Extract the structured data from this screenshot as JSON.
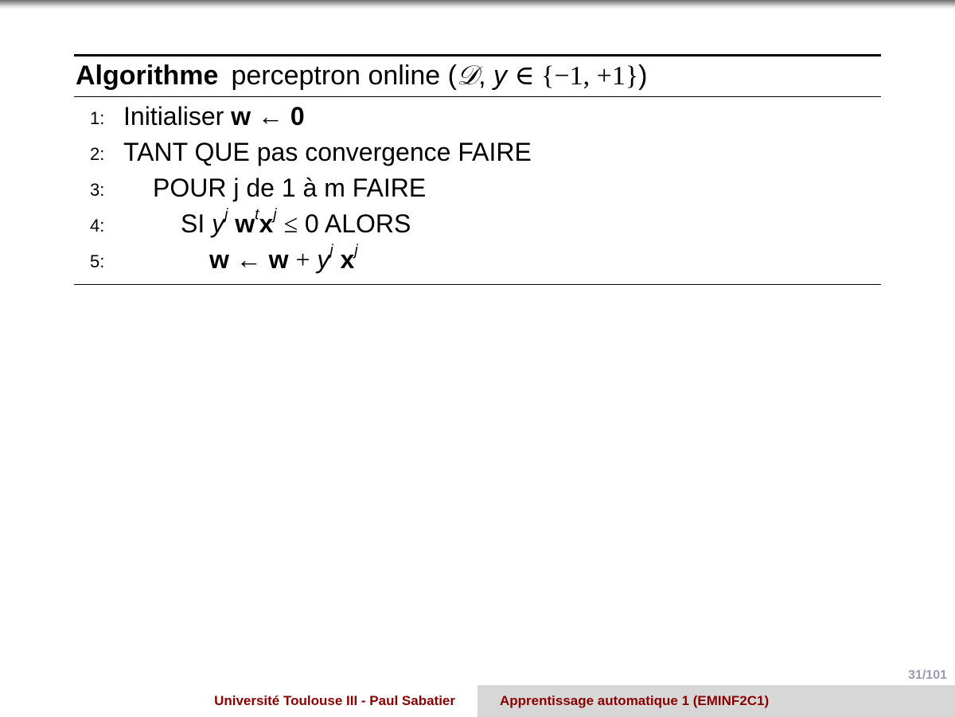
{
  "algorithm": {
    "keyword": "Algorithme",
    "name": "perceptron online",
    "args_math": "(𝒟, y ∈ {−1, +1})",
    "lines": [
      {
        "num": "1:",
        "text_a": "Initialiser",
        "w": "w",
        "arrow": "←",
        "zero": "0"
      },
      {
        "num": "2:",
        "text": "TANT QUE pas convergence FAIRE"
      },
      {
        "num": "3:",
        "text": "POUR j de 1 à m FAIRE"
      },
      {
        "num": "4:",
        "si": "SI",
        "y": "y",
        "j": "j",
        "w": "w",
        "t": "t",
        "x": "x",
        "leq": "≤",
        "zero": "0",
        "alors": "ALORS"
      },
      {
        "num": "5:",
        "w1": "w",
        "arrow": "←",
        "w2": "w",
        "plus": "+",
        "y": "y",
        "j": "j",
        "x": "x"
      }
    ]
  },
  "page_number": "31/101",
  "footer": {
    "institution": "Université Toulouse III - Paul Sabatier",
    "course": "Apprentissage automatique 1 (EMINF2C1)"
  }
}
